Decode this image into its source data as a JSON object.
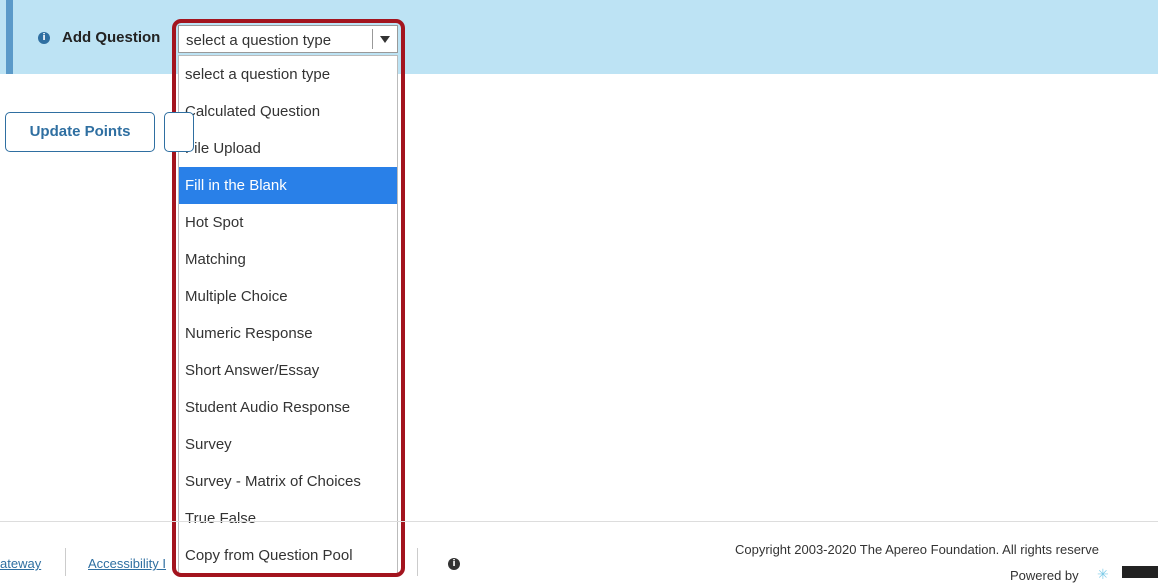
{
  "question_bar": {
    "info_icon": "info-icon",
    "label": "Add Question"
  },
  "select": {
    "value": "select a question type",
    "chevron_icon": "chevron-down-icon"
  },
  "dropdown": {
    "options": [
      "select a question type",
      "Calculated Question",
      "File Upload",
      "Fill in the Blank",
      "Hot Spot",
      "Matching",
      "Multiple Choice",
      "Numeric Response",
      "Short Answer/Essay",
      "Student Audio Response",
      "Survey",
      "Survey - Matrix of Choices",
      "True False",
      "Copy from Question Pool"
    ],
    "highlighted_option": "Fill in the Blank"
  },
  "buttons": {
    "update_points": "Update Points"
  },
  "footer": {
    "link_gateway": "ateway",
    "link_accessibility": "Accessibility I",
    "info_icon": "info-icon",
    "copyright": "Copyright 2003-2020 The Apereo Foundation. All rights reserve",
    "powered_by": "Powered by",
    "logo_icon": "sakai-logo-icon"
  },
  "colors": {
    "bar_background": "#bde3f4",
    "highlight_option": "#2980e8",
    "highlight_frame": "#a3141e",
    "link": "#2f6fa1"
  }
}
